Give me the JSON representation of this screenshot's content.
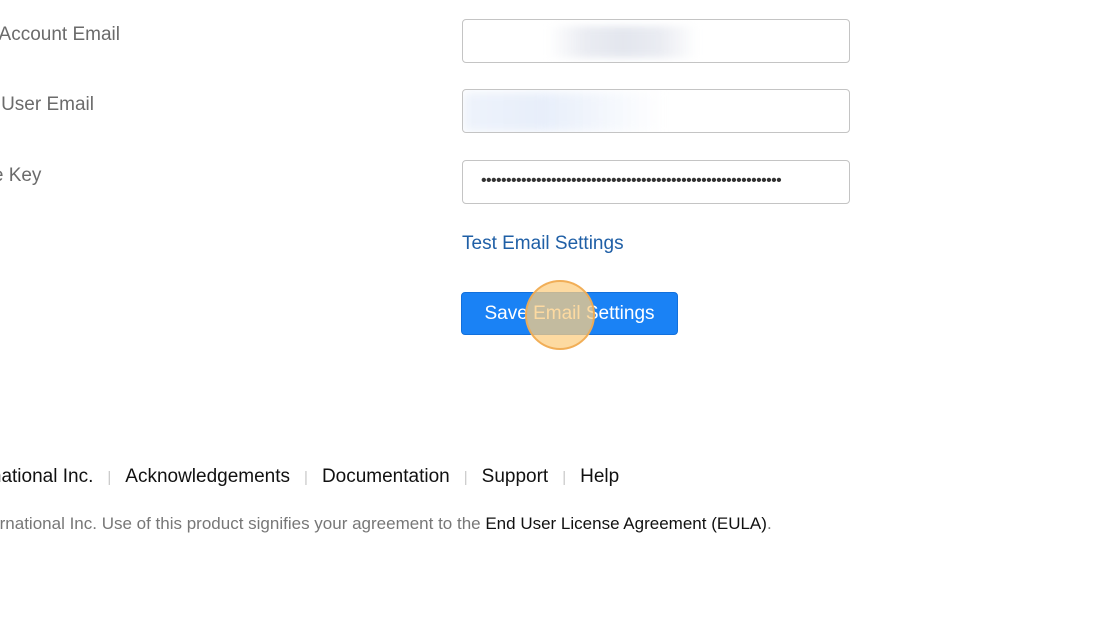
{
  "form": {
    "service_account_email_label": "ice Account Email",
    "service_account_email_value": "",
    "admin_user_email_label": "in User Email",
    "admin_user_email_value": "",
    "private_key_label": "ate Key",
    "private_key_value": "••••••••••••••••••••••••••••••••••••••••••••••••••••••••••••"
  },
  "actions": {
    "test_link": "Test Email Settings",
    "save_button": "Save Email Settings"
  },
  "footer": {
    "links": [
      "ernational Inc.",
      "Acknowledgements",
      "Documentation",
      "Support",
      "Help"
    ],
    "legal_prefix": "nternational Inc. Use of this product signifies your agreement to the ",
    "legal_link": "End User License Agreement (EULA)",
    "legal_suffix": "."
  },
  "colors": {
    "primary_button": "#1a82f5",
    "link": "#1f5fa6",
    "click_marker": "#fccd82"
  }
}
